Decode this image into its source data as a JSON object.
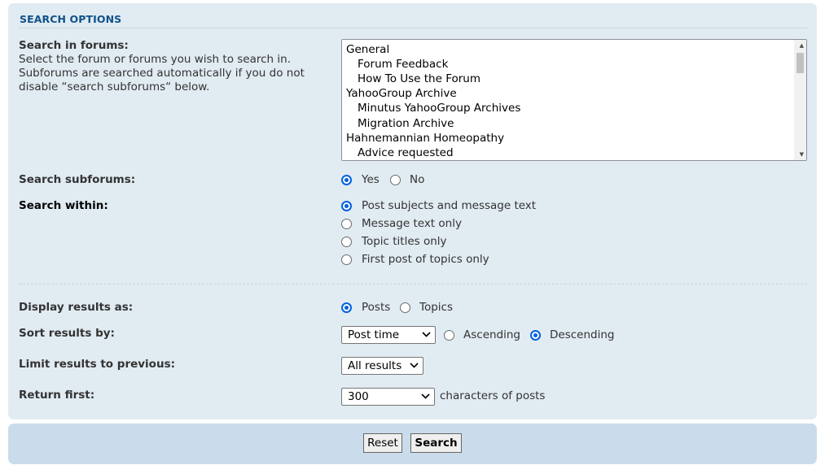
{
  "section": {
    "title": "SEARCH OPTIONS"
  },
  "forums": {
    "label": "Search in forums:",
    "description": "Select the forum or forums you wish to search in. Subforums are searched automatically if you do not disable “search subforums“ below.",
    "options": [
      {
        "text": "General",
        "level": 0
      },
      {
        "text": "Forum Feedback",
        "level": 1
      },
      {
        "text": "How To Use the Forum",
        "level": 1
      },
      {
        "text": "YahooGroup Archive",
        "level": 0
      },
      {
        "text": "Minutus YahooGroup Archives",
        "level": 1
      },
      {
        "text": "Migration Archive",
        "level": 1
      },
      {
        "text": "Hahnemannian Homeopathy",
        "level": 0
      },
      {
        "text": "Advice requested",
        "level": 1
      }
    ]
  },
  "subforums": {
    "label": "Search subforums:",
    "yes": "Yes",
    "no": "No",
    "selected": "Yes"
  },
  "within": {
    "label": "Search within:",
    "options": [
      "Post subjects and message text",
      "Message text only",
      "Topic titles only",
      "First post of topics only"
    ],
    "selected": "Post subjects and message text"
  },
  "display": {
    "label": "Display results as:",
    "posts": "Posts",
    "topics": "Topics",
    "selected": "Posts"
  },
  "sort": {
    "label": "Sort results by:",
    "field": "Post time",
    "ascending": "Ascending",
    "descending": "Descending",
    "selected_direction": "Descending"
  },
  "limit": {
    "label": "Limit results to previous:",
    "value": "All results"
  },
  "return_first": {
    "label": "Return first:",
    "value": "300",
    "suffix": "characters of posts"
  },
  "buttons": {
    "reset": "Reset",
    "search": "Search"
  },
  "colors": {
    "panel": "#e1ebf2",
    "footer": "#cadceb",
    "title": "#105289",
    "radio_accent": "#0060df"
  },
  "icons": {
    "select_arrow": "chevron-down-icon",
    "scroll_up": "scroll-up-arrow-icon",
    "scroll_down": "scroll-down-arrow-icon"
  }
}
